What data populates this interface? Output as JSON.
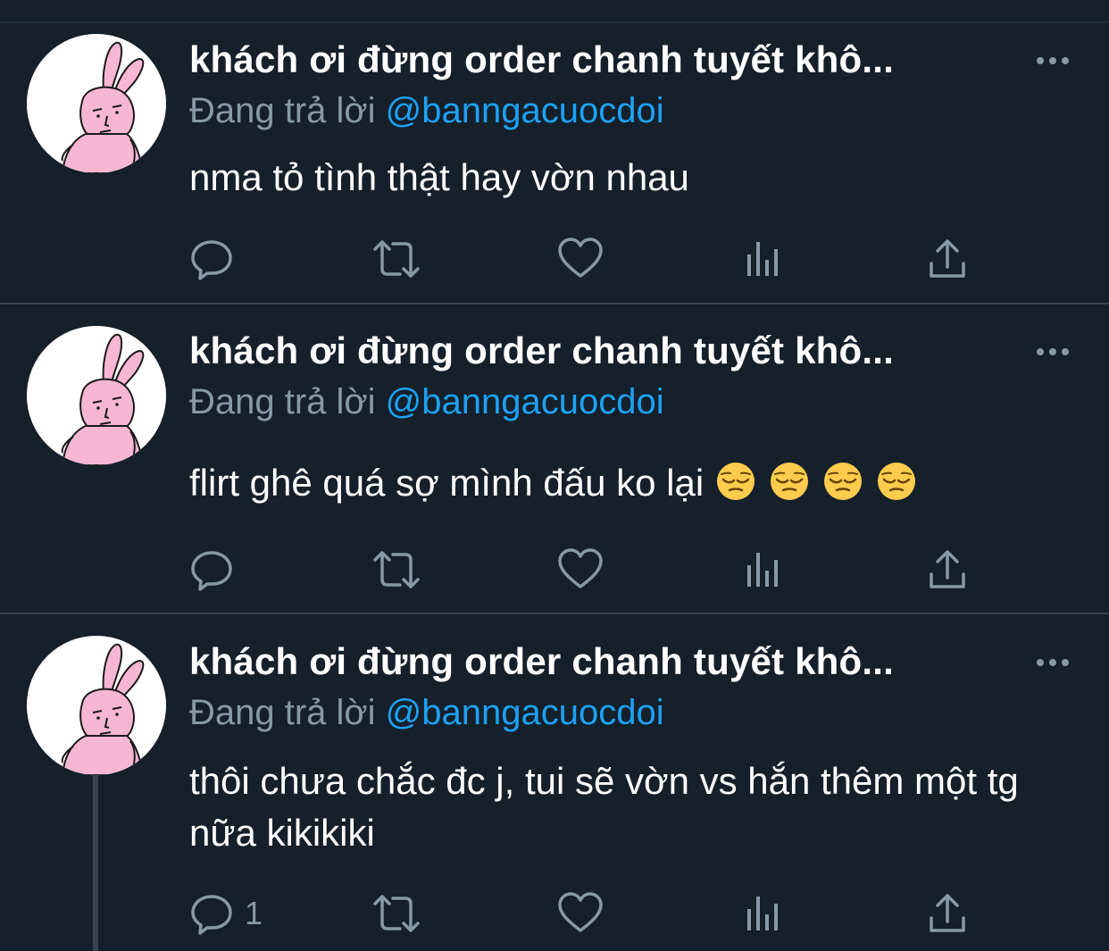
{
  "tweets": [
    {
      "author": "khách ơi đừng order chanh tuyết khô...",
      "reply_prefix": "Đang trả lời",
      "reply_handle": "@banngacuocdoi",
      "text": "nma tỏ tình thật hay vờn nhau",
      "emoji_count": 0,
      "reply_count": ""
    },
    {
      "author": "khách ơi đừng order chanh tuyết khô...",
      "reply_prefix": "Đang trả lời",
      "reply_handle": "@banngacuocdoi",
      "text": "flirt ghê quá sợ mình đấu ko lại",
      "emoji_count": 4,
      "reply_count": ""
    },
    {
      "author": "khách ơi đừng order chanh tuyết khô...",
      "reply_prefix": "Đang trả lời",
      "reply_handle": "@banngacuocdoi",
      "text": "thôi chưa chắc đc j, tui sẽ vờn vs hắn thêm một tg nữa kikikiki",
      "emoji_count": 0,
      "reply_count": "1"
    }
  ],
  "icons": {
    "more": "more-horizontal-icon",
    "reply": "reply-bubble-icon",
    "retweet": "retweet-icon",
    "like": "heart-icon",
    "analytics": "analytics-bars-icon",
    "share": "share-upload-icon",
    "emoji": "pensive-face-emoji"
  },
  "colors": {
    "background": "#15202b",
    "text": "#ffffff",
    "secondary": "#8899a6",
    "link": "#1da1f2",
    "divider": "#38444d",
    "avatar_pink": "#f7b6d2"
  }
}
